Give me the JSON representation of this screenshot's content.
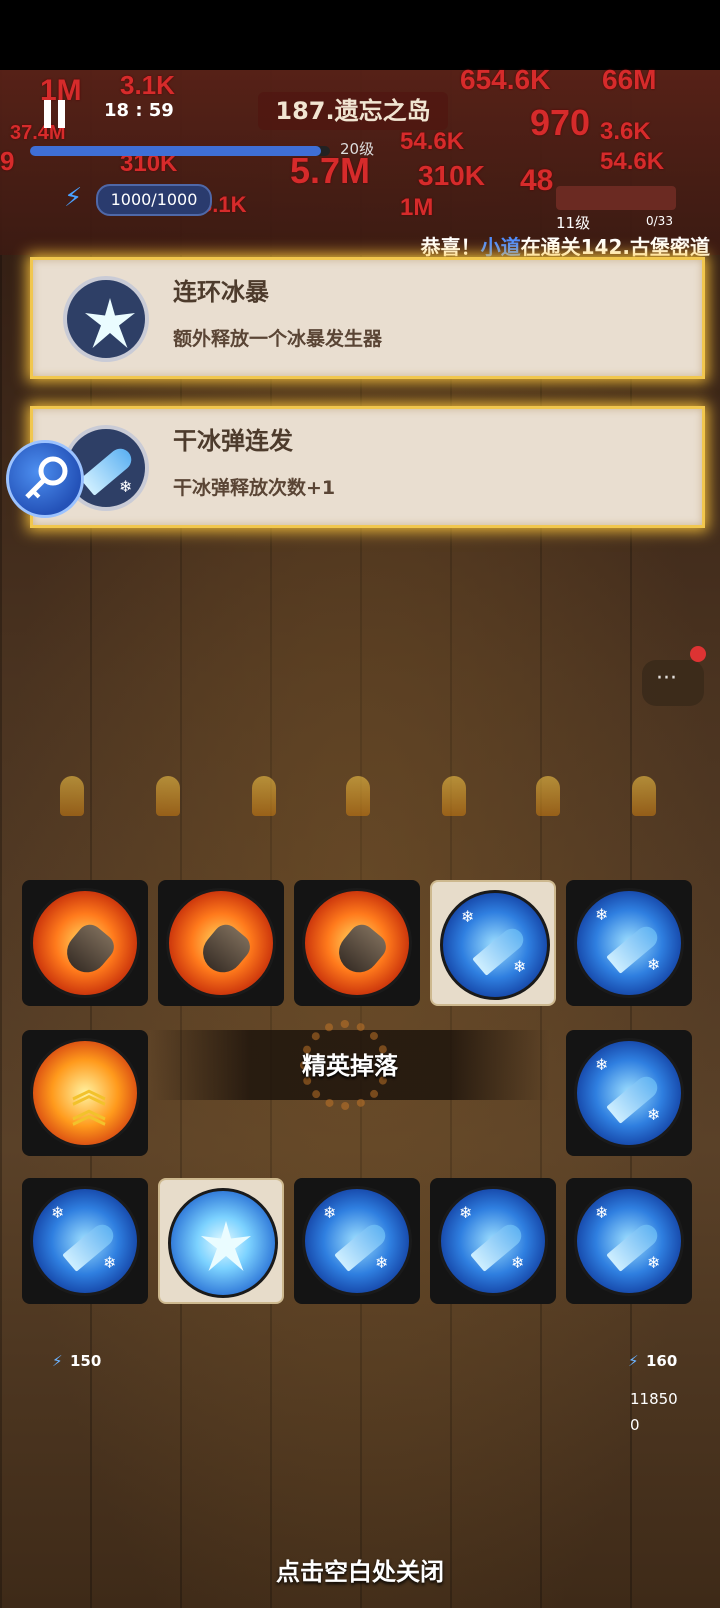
{
  "hud": {
    "timer": "18 : 59",
    "stage_title": "187.遗忘之岛",
    "wave_label": "20级",
    "progress": 0.97,
    "energy": "1000/1000",
    "level_label": "11级",
    "level_count": "0/33"
  },
  "damage_numbers": [
    "3.1K",
    "654.6K",
    "66M",
    "1M",
    "18:59",
    "37.4M",
    "9",
    "54.6K",
    "970",
    "3.6K",
    "3.1K",
    "310K",
    "5.7M",
    "1M",
    "310K",
    "48",
    "54.6K",
    "3.1K",
    "54.6K",
    "1M",
    "6"
  ],
  "announcement": {
    "prefix": "恭喜！",
    "player": "小道",
    "suffix": "在通关142.古堡密道"
  },
  "skill_choices": [
    {
      "name": "连环冰暴",
      "description": "额外释放一个冰暴发生器",
      "icon": "ice-crystal-icon"
    },
    {
      "name": "干冰弹连发",
      "description": "干冰弹释放次数+1",
      "icon": "ice-missile-icon"
    }
  ],
  "side_icon": "magnifier-key-icon",
  "skill_grid": {
    "row1": [
      "fire-bullet-icon",
      "fire-bullet-icon",
      "fire-bullet-icon",
      "ice-missile-icon",
      "ice-missile-icon"
    ],
    "row1_selected": [
      false,
      false,
      false,
      true,
      false
    ],
    "row2_left": "armor-upgrade-icon",
    "row2_right": "ice-missile-icon",
    "row3": [
      "ice-missile-icon",
      "ice-crystal-icon",
      "ice-missile-icon",
      "ice-missile-icon",
      "ice-missile-icon"
    ],
    "row3_selected": [
      false,
      true,
      false,
      false,
      false
    ]
  },
  "elite_label": "精英掉落",
  "bottom_stats": {
    "left_energy": "150",
    "right_energy": "160",
    "score": "11850",
    "zero": "0"
  },
  "close_hint": "点击空白处关闭"
}
